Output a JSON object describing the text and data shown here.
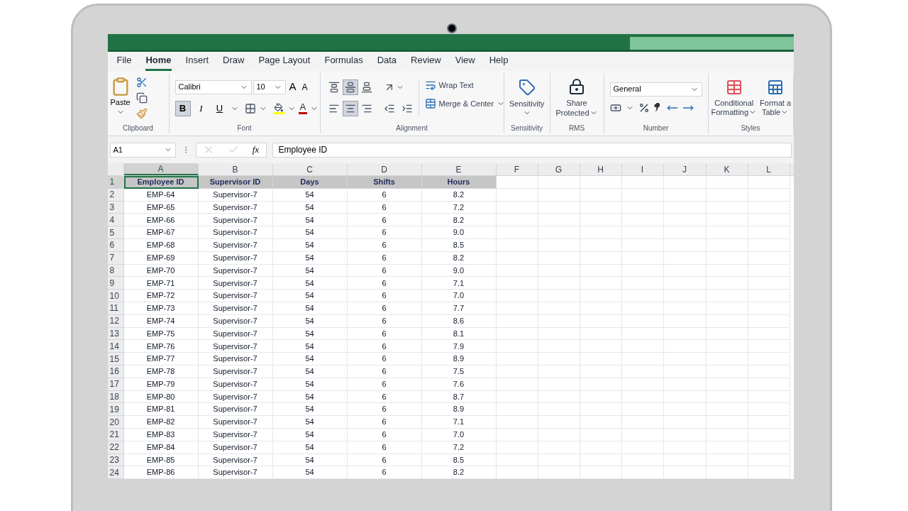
{
  "tabs": [
    {
      "label": "File",
      "selected": false
    },
    {
      "label": "Home",
      "selected": true
    },
    {
      "label": "Insert",
      "selected": false
    },
    {
      "label": "Draw",
      "selected": false
    },
    {
      "label": "Page Layout",
      "selected": false
    },
    {
      "label": "Formulas",
      "selected": false
    },
    {
      "label": "Data",
      "selected": false
    },
    {
      "label": "Review",
      "selected": false
    },
    {
      "label": "View",
      "selected": false
    },
    {
      "label": "Help",
      "selected": false
    }
  ],
  "ribbon": {
    "clipboard": {
      "label": "Clipboard",
      "paste": "Paste"
    },
    "font": {
      "label": "Font",
      "name": "Calibri",
      "size": "10",
      "grow": "A",
      "shrink": "A",
      "bold": {
        "text": "B",
        "selected": true
      },
      "italic": {
        "text": "I",
        "selected": false
      },
      "underline": {
        "text": "U",
        "selected": false
      },
      "color_letter": "A"
    },
    "alignment": {
      "label": "Alignment",
      "vertical": [
        {
          "selected": false
        },
        {
          "selected": true
        },
        {
          "selected": false
        }
      ],
      "horizontal": [
        {
          "selected": false
        },
        {
          "selected": true
        },
        {
          "selected": false
        }
      ],
      "wrap": "Wrap Text",
      "merge": "Merge & Center"
    },
    "sensitivity": {
      "label": "Sensitivity",
      "button": "Sensitivity"
    },
    "rms": {
      "label": "RMS",
      "button": [
        "Share",
        "Protected"
      ]
    },
    "number": {
      "label": "Number",
      "format": "General"
    },
    "styles": {
      "label": "Styles",
      "conditional": [
        "Conditional",
        "Formatting"
      ],
      "table": [
        "Format a",
        "Table"
      ]
    }
  },
  "formula_bar": {
    "name_box": "A1",
    "fx": "fx",
    "value": "Employee ID"
  },
  "columns": [
    {
      "letter": "A",
      "selected": true
    },
    {
      "letter": "B",
      "selected": false
    },
    {
      "letter": "C",
      "selected": false
    },
    {
      "letter": "D",
      "selected": false
    },
    {
      "letter": "E",
      "selected": false
    },
    {
      "letter": "F",
      "selected": false
    },
    {
      "letter": "G",
      "selected": false
    },
    {
      "letter": "H",
      "selected": false
    },
    {
      "letter": "I",
      "selected": false
    },
    {
      "letter": "J",
      "selected": false
    },
    {
      "letter": "K",
      "selected": false
    },
    {
      "letter": "L",
      "selected": false
    }
  ],
  "rows": [
    {
      "number": "1",
      "selected": true,
      "cells": [
        "Employee ID",
        "Supervisor ID",
        "Days",
        "Shifts",
        "Hours"
      ]
    },
    {
      "number": "2",
      "selected": false,
      "cells": [
        "EMP-64",
        "Supervisor-7",
        "54",
        "6",
        "8.2"
      ]
    },
    {
      "number": "3",
      "selected": false,
      "cells": [
        "EMP-65",
        "Supervisor-7",
        "54",
        "6",
        "7.2"
      ]
    },
    {
      "number": "4",
      "selected": false,
      "cells": [
        "EMP-66",
        "Supervisor-7",
        "54",
        "6",
        "8.2"
      ]
    },
    {
      "number": "5",
      "selected": false,
      "cells": [
        "EMP-67",
        "Supervisor-7",
        "54",
        "6",
        "9.0"
      ]
    },
    {
      "number": "6",
      "selected": false,
      "cells": [
        "EMP-68",
        "Supervisor-7",
        "54",
        "6",
        "8.5"
      ]
    },
    {
      "number": "7",
      "selected": false,
      "cells": [
        "EMP-69",
        "Supervisor-7",
        "54",
        "6",
        "8.2"
      ]
    },
    {
      "number": "8",
      "selected": false,
      "cells": [
        "EMP-70",
        "Supervisor-7",
        "54",
        "6",
        "9.0"
      ]
    },
    {
      "number": "9",
      "selected": false,
      "cells": [
        "EMP-71",
        "Supervisor-7",
        "54",
        "6",
        "7.1"
      ]
    },
    {
      "number": "10",
      "selected": false,
      "cells": [
        "EMP-72",
        "Supervisor-7",
        "54",
        "6",
        "7.0"
      ]
    },
    {
      "number": "11",
      "selected": false,
      "cells": [
        "EMP-73",
        "Supervisor-7",
        "54",
        "6",
        "7.7"
      ]
    },
    {
      "number": "12",
      "selected": false,
      "cells": [
        "EMP-74",
        "Supervisor-7",
        "54",
        "6",
        "8.6"
      ]
    },
    {
      "number": "13",
      "selected": false,
      "cells": [
        "EMP-75",
        "Supervisor-7",
        "54",
        "6",
        "8.1"
      ]
    },
    {
      "number": "14",
      "selected": false,
      "cells": [
        "EMP-76",
        "Supervisor-7",
        "54",
        "6",
        "7.9"
      ]
    },
    {
      "number": "15",
      "selected": false,
      "cells": [
        "EMP-77",
        "Supervisor-7",
        "54",
        "6",
        "8.9"
      ]
    },
    {
      "number": "16",
      "selected": false,
      "cells": [
        "EMP-78",
        "Supervisor-7",
        "54",
        "6",
        "7.5"
      ]
    },
    {
      "number": "17",
      "selected": false,
      "cells": [
        "EMP-79",
        "Supervisor-7",
        "54",
        "6",
        "7.6"
      ]
    },
    {
      "number": "18",
      "selected": false,
      "cells": [
        "EMP-80",
        "Supervisor-7",
        "54",
        "6",
        "8.7"
      ]
    },
    {
      "number": "19",
      "selected": false,
      "cells": [
        "EMP-81",
        "Supervisor-7",
        "54",
        "6",
        "8.9"
      ]
    },
    {
      "number": "20",
      "selected": false,
      "cells": [
        "EMP-82",
        "Supervisor-7",
        "54",
        "6",
        "7.1"
      ]
    },
    {
      "number": "21",
      "selected": false,
      "cells": [
        "EMP-83",
        "Supervisor-7",
        "54",
        "6",
        "7.0"
      ]
    },
    {
      "number": "22",
      "selected": false,
      "cells": [
        "EMP-84",
        "Supervisor-7",
        "54",
        "6",
        "7.2"
      ]
    },
    {
      "number": "23",
      "selected": false,
      "cells": [
        "EMP-85",
        "Supervisor-7",
        "54",
        "6",
        "8.5"
      ]
    },
    {
      "number": "24",
      "selected": false,
      "cells": [
        "EMP-86",
        "Supervisor-7",
        "54",
        "6",
        "8.2"
      ]
    }
  ]
}
